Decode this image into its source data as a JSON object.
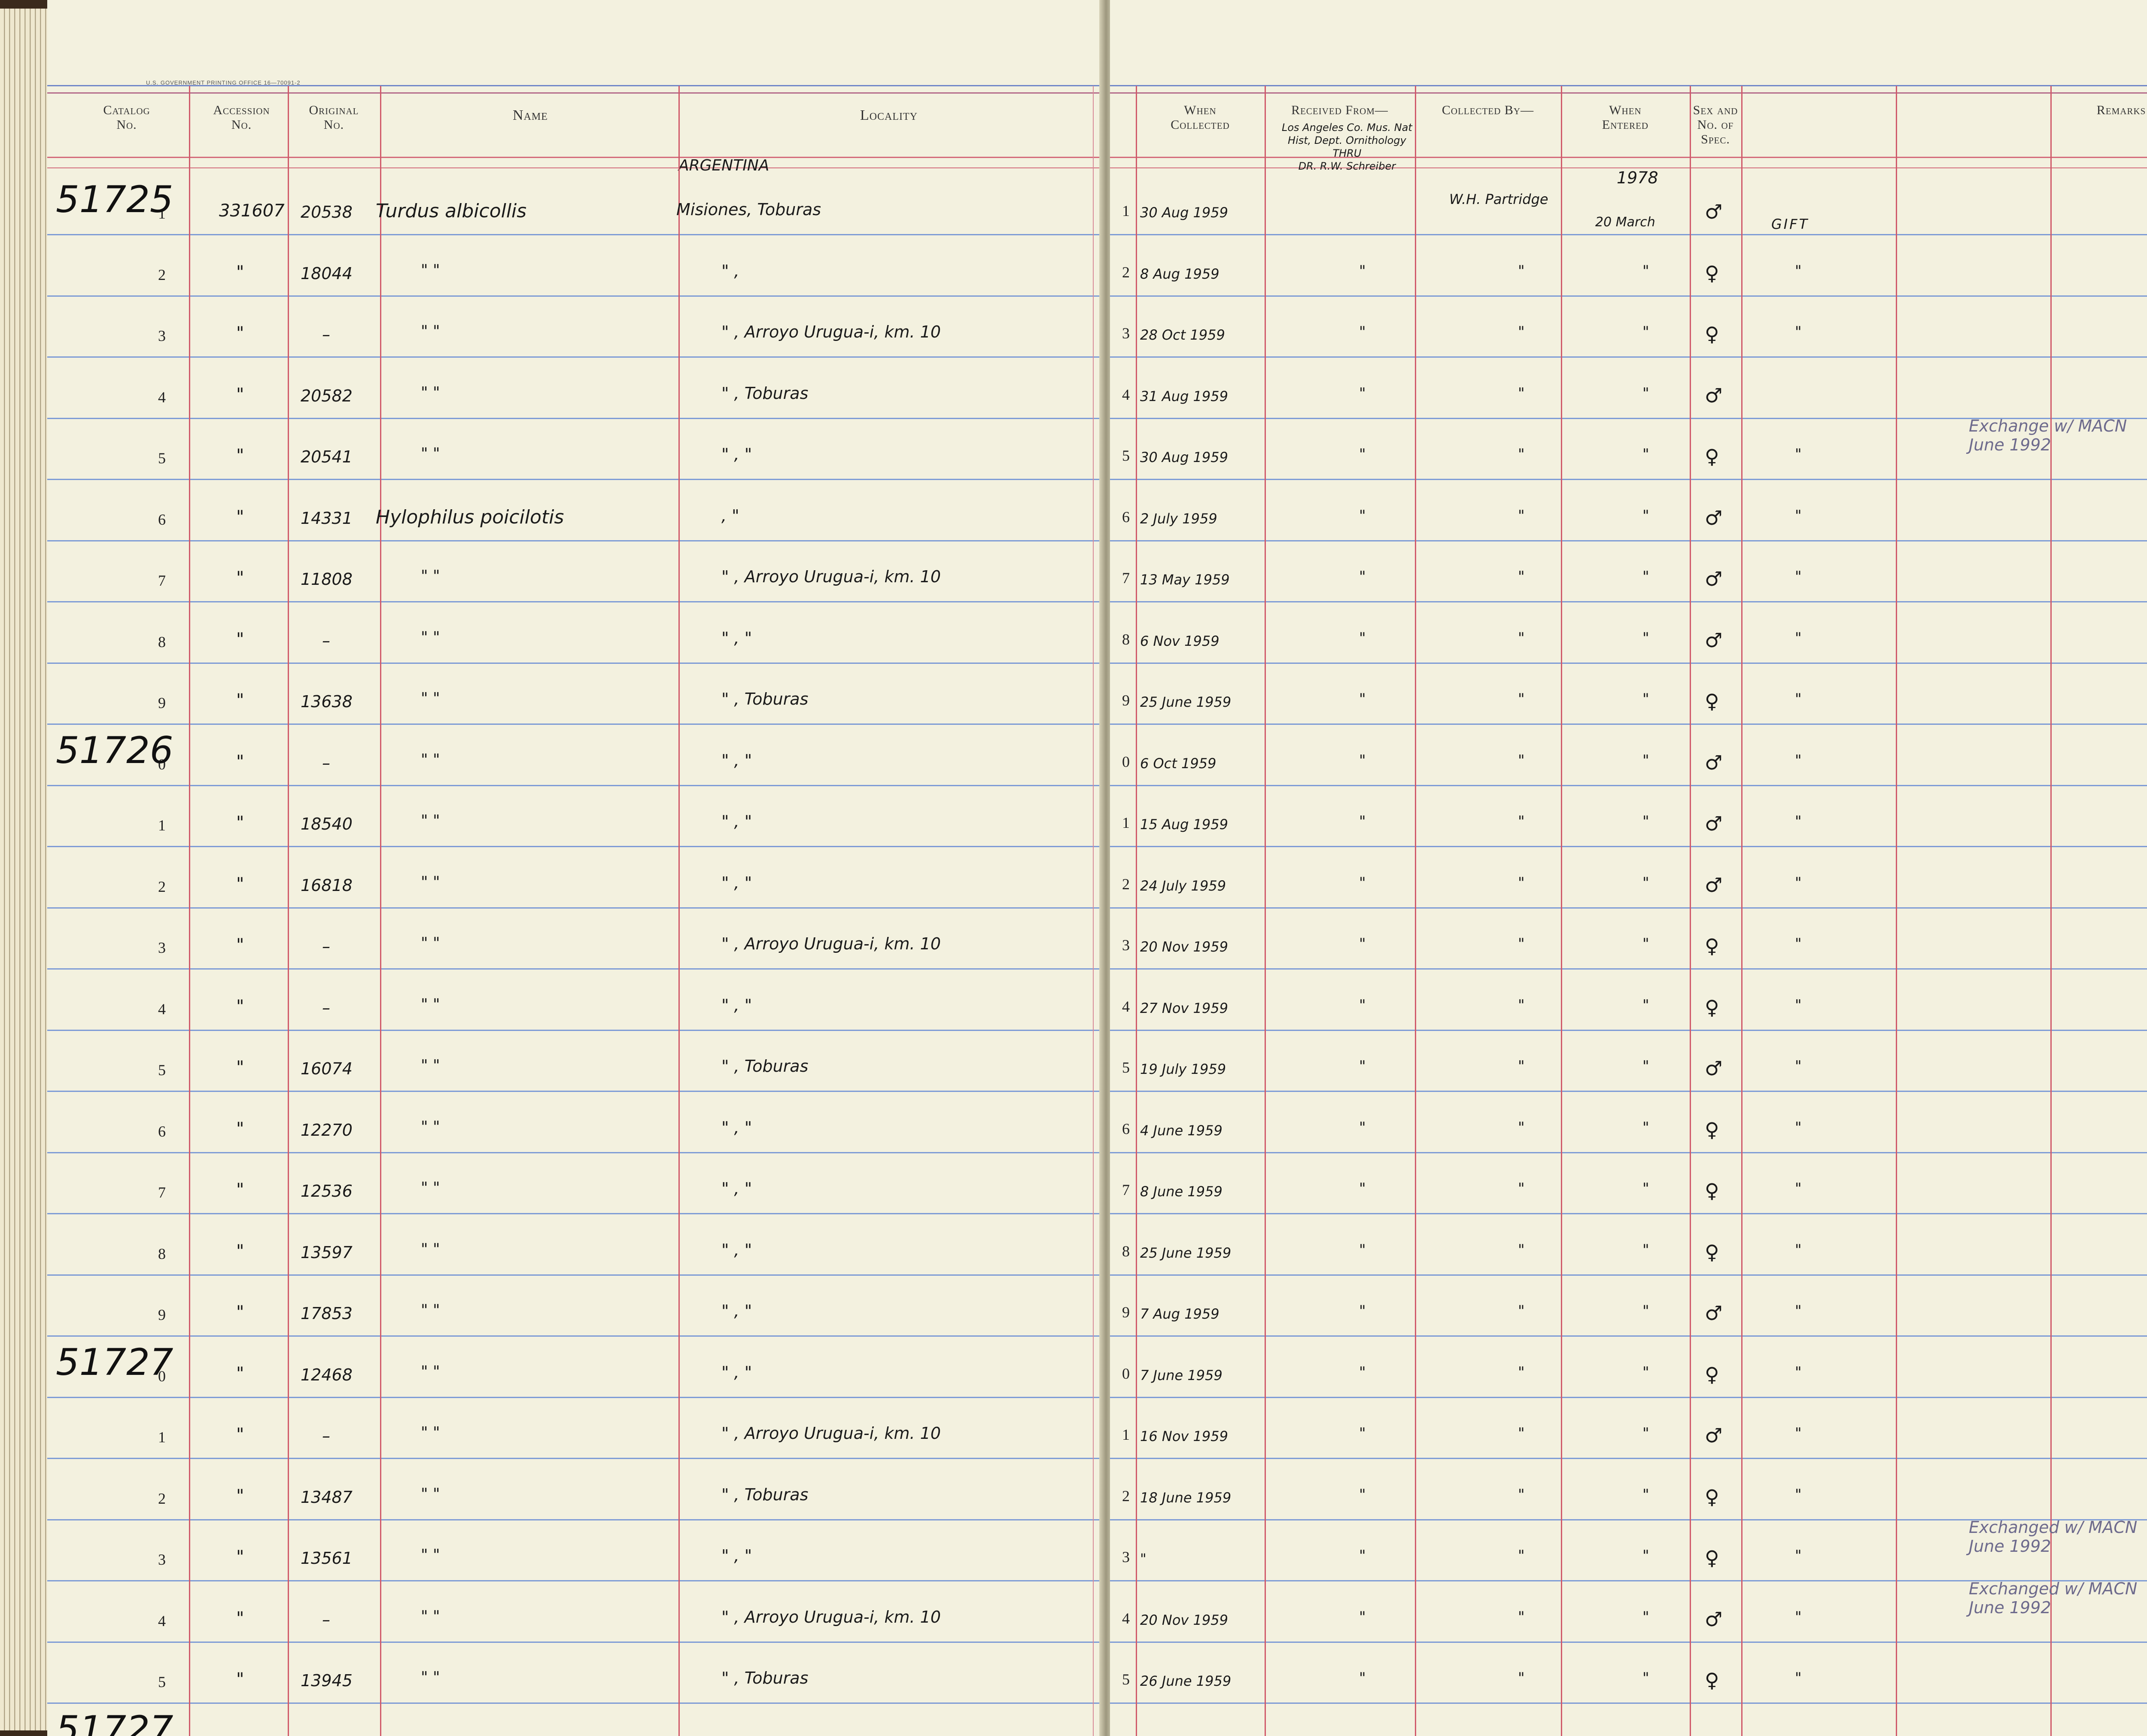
{
  "header": {
    "printer_line": "U.S. GOVERNMENT PRINTING OFFICE   16—70091-2",
    "left_columns": [
      "Catalog\nNo.",
      "Accession\nNo.",
      "Original\nNo.",
      "Name",
      "Locality"
    ],
    "right_columns": [
      "When\nCollected",
      "Received From—",
      "Collected By—",
      "When\nEntered",
      "Sex and\nNo. of\nSpec.",
      "Remarks"
    ]
  },
  "top_notes": {
    "country": "ARGENTINA",
    "received_from": "Los Angeles Co. Mus. Nat\nHist, Dept. Ornithology\nTHRU\nDR. R.W. Schreiber",
    "collected_by": "W.H. Partridge",
    "entered_year": "1978",
    "entered_date": "20 March",
    "gift": "GIFT"
  },
  "catalog_markers": [
    {
      "row": 0,
      "label": "51725"
    },
    {
      "row": 9,
      "label": "51726"
    },
    {
      "row": 19,
      "label": "51727"
    },
    {
      "row": 25,
      "label": "51727"
    }
  ],
  "rows": [
    {
      "n": "1",
      "acc": "331607",
      "orig": "20538",
      "name": "Turdus albicollis",
      "loc": "Misiones, Toburas",
      "rnum": "1",
      "when": "30 Aug 1959",
      "recv": "",
      "coll": "",
      "ent": "",
      "sex": "♂",
      "rem": ""
    },
    {
      "n": "2",
      "acc": "\"",
      "orig": "18044",
      "name": "\"        \"",
      "loc": "\"        ,",
      "rnum": "2",
      "when": "8 Aug 1959",
      "recv": "\"",
      "coll": "\"",
      "ent": "\"",
      "sex": "♀",
      "rem": "\""
    },
    {
      "n": "3",
      "acc": "\"",
      "orig": "–",
      "name": "\"        \"",
      "loc": "\"   , Arroyo Urugua-i, km. 10",
      "rnum": "3",
      "when": "28 Oct 1959",
      "recv": "\"",
      "coll": "\"",
      "ent": "\"",
      "sex": "♀",
      "rem": "\""
    },
    {
      "n": "4",
      "acc": "\"",
      "orig": "20582",
      "name": "\"        \"",
      "loc": "\"   , Toburas",
      "rnum": "4",
      "when": "31 Aug 1959",
      "recv": "\"",
      "coll": "\"",
      "ent": "\"",
      "sex": "♂",
      "rem": ""
    },
    {
      "n": "5",
      "acc": "\"",
      "orig": "20541",
      "name": "\"        \"",
      "loc": "\"   ,      \"",
      "rnum": "5",
      "when": "30 Aug 1959",
      "recv": "\"",
      "coll": "\"",
      "ent": "\"",
      "sex": "♀",
      "rem": "\""
    },
    {
      "n": "6",
      "acc": "\"",
      "orig": "14331",
      "name": "Hylophilus poicilotis",
      "loc": "      ,      \"",
      "rnum": "6",
      "when": "2 July 1959",
      "recv": "\"",
      "coll": "\"",
      "ent": "\"",
      "sex": "♂",
      "rem": "\""
    },
    {
      "n": "7",
      "acc": "\"",
      "orig": "11808",
      "name": "\"        \"",
      "loc": "\"   , Arroyo Urugua-i, km. 10",
      "rnum": "7",
      "when": "13 May 1959",
      "recv": "\"",
      "coll": "\"",
      "ent": "\"",
      "sex": "♂",
      "rem": "\""
    },
    {
      "n": "8",
      "acc": "\"",
      "orig": "–",
      "name": "\"        \"",
      "loc": "\"   ,      \"",
      "rnum": "8",
      "when": "6 Nov 1959",
      "recv": "\"",
      "coll": "\"",
      "ent": "\"",
      "sex": "♂",
      "rem": "\""
    },
    {
      "n": "9",
      "acc": "\"",
      "orig": "13638",
      "name": "\"        \"",
      "loc": "\"   , Toburas",
      "rnum": "9",
      "when": "25 June 1959",
      "recv": "\"",
      "coll": "\"",
      "ent": "\"",
      "sex": "♀",
      "rem": "\""
    },
    {
      "n": "0",
      "acc": "\"",
      "orig": "–",
      "name": "\"        \"",
      "loc": "\"   ,      \"",
      "rnum": "0",
      "when": "6 Oct 1959",
      "recv": "\"",
      "coll": "\"",
      "ent": "\"",
      "sex": "♂",
      "rem": "\""
    },
    {
      "n": "1",
      "acc": "\"",
      "orig": "18540",
      "name": "\"        \"",
      "loc": "\"   ,      \"",
      "rnum": "1",
      "when": "15 Aug 1959",
      "recv": "\"",
      "coll": "\"",
      "ent": "\"",
      "sex": "♂",
      "rem": "\""
    },
    {
      "n": "2",
      "acc": "\"",
      "orig": "16818",
      "name": "\"        \"",
      "loc": "\"   ,      \"",
      "rnum": "2",
      "when": "24 July 1959",
      "recv": "\"",
      "coll": "\"",
      "ent": "\"",
      "sex": "♂",
      "rem": "\""
    },
    {
      "n": "3",
      "acc": "\"",
      "orig": "–",
      "name": "\"        \"",
      "loc": "\"   , Arroyo Urugua-i, km. 10",
      "rnum": "3",
      "when": "20 Nov 1959",
      "recv": "\"",
      "coll": "\"",
      "ent": "\"",
      "sex": "♀",
      "rem": "\""
    },
    {
      "n": "4",
      "acc": "\"",
      "orig": "–",
      "name": "\"        \"",
      "loc": "\"   ,      \"",
      "rnum": "4",
      "when": "27 Nov 1959",
      "recv": "\"",
      "coll": "\"",
      "ent": "\"",
      "sex": "♀",
      "rem": "\""
    },
    {
      "n": "5",
      "acc": "\"",
      "orig": "16074",
      "name": "\"        \"",
      "loc": "\"   , Toburas",
      "rnum": "5",
      "when": "19 July 1959",
      "recv": "\"",
      "coll": "\"",
      "ent": "\"",
      "sex": "♂",
      "rem": "\""
    },
    {
      "n": "6",
      "acc": "\"",
      "orig": "12270",
      "name": "\"        \"",
      "loc": "\"   ,      \"",
      "rnum": "6",
      "when": "4 June 1959",
      "recv": "\"",
      "coll": "\"",
      "ent": "\"",
      "sex": "♀",
      "rem": "\""
    },
    {
      "n": "7",
      "acc": "\"",
      "orig": "12536",
      "name": "\"        \"",
      "loc": "\"   ,      \"",
      "rnum": "7",
      "when": "8 June 1959",
      "recv": "\"",
      "coll": "\"",
      "ent": "\"",
      "sex": "♀",
      "rem": "\""
    },
    {
      "n": "8",
      "acc": "\"",
      "orig": "13597",
      "name": "\"        \"",
      "loc": "\"   ,      \"",
      "rnum": "8",
      "when": "25 June 1959",
      "recv": "\"",
      "coll": "\"",
      "ent": "\"",
      "sex": "♀",
      "rem": "\""
    },
    {
      "n": "9",
      "acc": "\"",
      "orig": "17853",
      "name": "\"        \"",
      "loc": "\"   ,      \"",
      "rnum": "9",
      "when": "7 Aug 1959",
      "recv": "\"",
      "coll": "\"",
      "ent": "\"",
      "sex": "♂",
      "rem": "\""
    },
    {
      "n": "0",
      "acc": "\"",
      "orig": "12468",
      "name": "\"        \"",
      "loc": "\"   ,      \"",
      "rnum": "0",
      "when": "7 June 1959",
      "recv": "\"",
      "coll": "\"",
      "ent": "\"",
      "sex": "♀",
      "rem": "\""
    },
    {
      "n": "1",
      "acc": "\"",
      "orig": "–",
      "name": "\"        \"",
      "loc": "\"   , Arroyo Urugua-i, km. 10",
      "rnum": "1",
      "when": "16 Nov 1959",
      "recv": "\"",
      "coll": "\"",
      "ent": "\"",
      "sex": "♂",
      "rem": "\""
    },
    {
      "n": "2",
      "acc": "\"",
      "orig": "13487",
      "name": "\"        \"",
      "loc": "\"   , Toburas",
      "rnum": "2",
      "when": "18 June 1959",
      "recv": "\"",
      "coll": "\"",
      "ent": "\"",
      "sex": "♀",
      "rem": "\""
    },
    {
      "n": "3",
      "acc": "\"",
      "orig": "13561",
      "name": "\"        \"",
      "loc": "\"   ,      \"",
      "rnum": "3",
      "when": "\"",
      "recv": "\"",
      "coll": "\"",
      "ent": "\"",
      "sex": "♀",
      "rem": "\""
    },
    {
      "n": "4",
      "acc": "\"",
      "orig": "–",
      "name": "\"        \"",
      "loc": "\"   , Arroyo Urugua-i, km. 10",
      "rnum": "4",
      "when": "20 Nov 1959",
      "recv": "\"",
      "coll": "\"",
      "ent": "\"",
      "sex": "♂",
      "rem": "\""
    },
    {
      "n": "5",
      "acc": "\"",
      "orig": "13945",
      "name": "\"        \"",
      "loc": "\"   , Toburas",
      "rnum": "5",
      "when": "26 June 1959",
      "recv": "\"",
      "coll": "\"",
      "ent": "\"",
      "sex": "♀",
      "rem": "\""
    }
  ],
  "remarks": [
    {
      "row": 4,
      "text": "Exchange w/ MACN\nJune 1992"
    },
    {
      "row": 22,
      "text": "Exchanged w/ MACN\nJune 1992"
    },
    {
      "row": 23,
      "text": "Exchanged w/ MACN\nJune 1992"
    }
  ]
}
